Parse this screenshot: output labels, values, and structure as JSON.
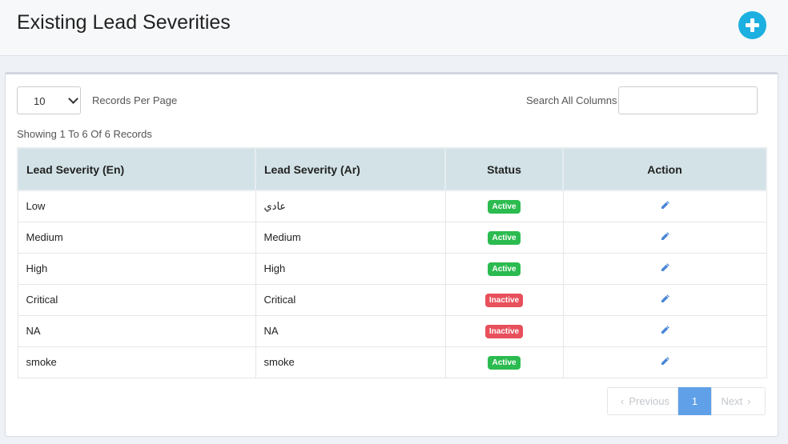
{
  "header": {
    "title": "Existing Lead Severities"
  },
  "controls": {
    "page_length": "10",
    "records_per_page_label": "Records Per Page",
    "search_label": "Search All Columns",
    "search_value": ""
  },
  "info": "Showing 1 To 6 Of 6 Records",
  "table": {
    "columns": [
      "Lead Severity (En)",
      "Lead Severity (Ar)",
      "Status",
      "Action"
    ],
    "rows": [
      {
        "en": "Low",
        "ar": "عادي",
        "status": "Active"
      },
      {
        "en": "Medium",
        "ar": "Medium",
        "status": "Active"
      },
      {
        "en": "High",
        "ar": "High",
        "status": "Active"
      },
      {
        "en": "Critical",
        "ar": "Critical",
        "status": "Inactive"
      },
      {
        "en": "NA",
        "ar": "NA",
        "status": "Inactive"
      },
      {
        "en": "smoke",
        "ar": "smoke",
        "status": "Active"
      }
    ]
  },
  "pagination": {
    "previous": "Previous",
    "current": "1",
    "next": "Next"
  },
  "colors": {
    "add_button": "#1bb0e0",
    "active": "#2bbb4f",
    "inactive": "#e8505b",
    "header_bg": "#d2e2e6",
    "current_page": "#5fa0e8",
    "edit_icon": "#4a86d6"
  },
  "icons": {
    "add": "plus-circle-icon",
    "edit": "pencil-icon"
  }
}
